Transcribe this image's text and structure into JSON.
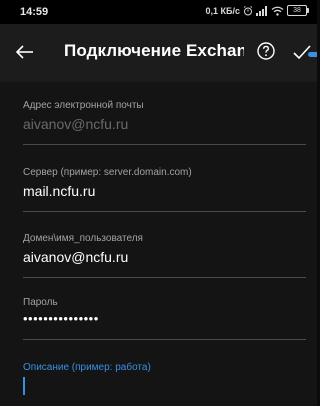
{
  "status_bar": {
    "time": "14:59",
    "net_speed": "0,1 КБ/с",
    "battery": "38"
  },
  "app_bar": {
    "title": "Подключение Exchan...",
    "back_icon": "arrow-left-icon",
    "help_icon": "help-circle-icon",
    "confirm_icon": "checkmark-icon"
  },
  "form": {
    "email": {
      "label": "Адрес электронной почты",
      "value": "aivanov@ncfu.ru"
    },
    "server": {
      "label": "Сервер (пример: server.domain.com)",
      "value": "mail.ncfu.ru"
    },
    "domain_user": {
      "label": "Домен\\имя_пользователя",
      "value": "aivanov@ncfu.ru"
    },
    "password": {
      "label": "Пароль",
      "value": "•••••••••••••••"
    },
    "description": {
      "label": "Описание (пример: работа)",
      "value": ""
    }
  },
  "colors": {
    "accent": "#3a8ee6",
    "background": "#141414",
    "app_bar": "#1c1c1c"
  }
}
